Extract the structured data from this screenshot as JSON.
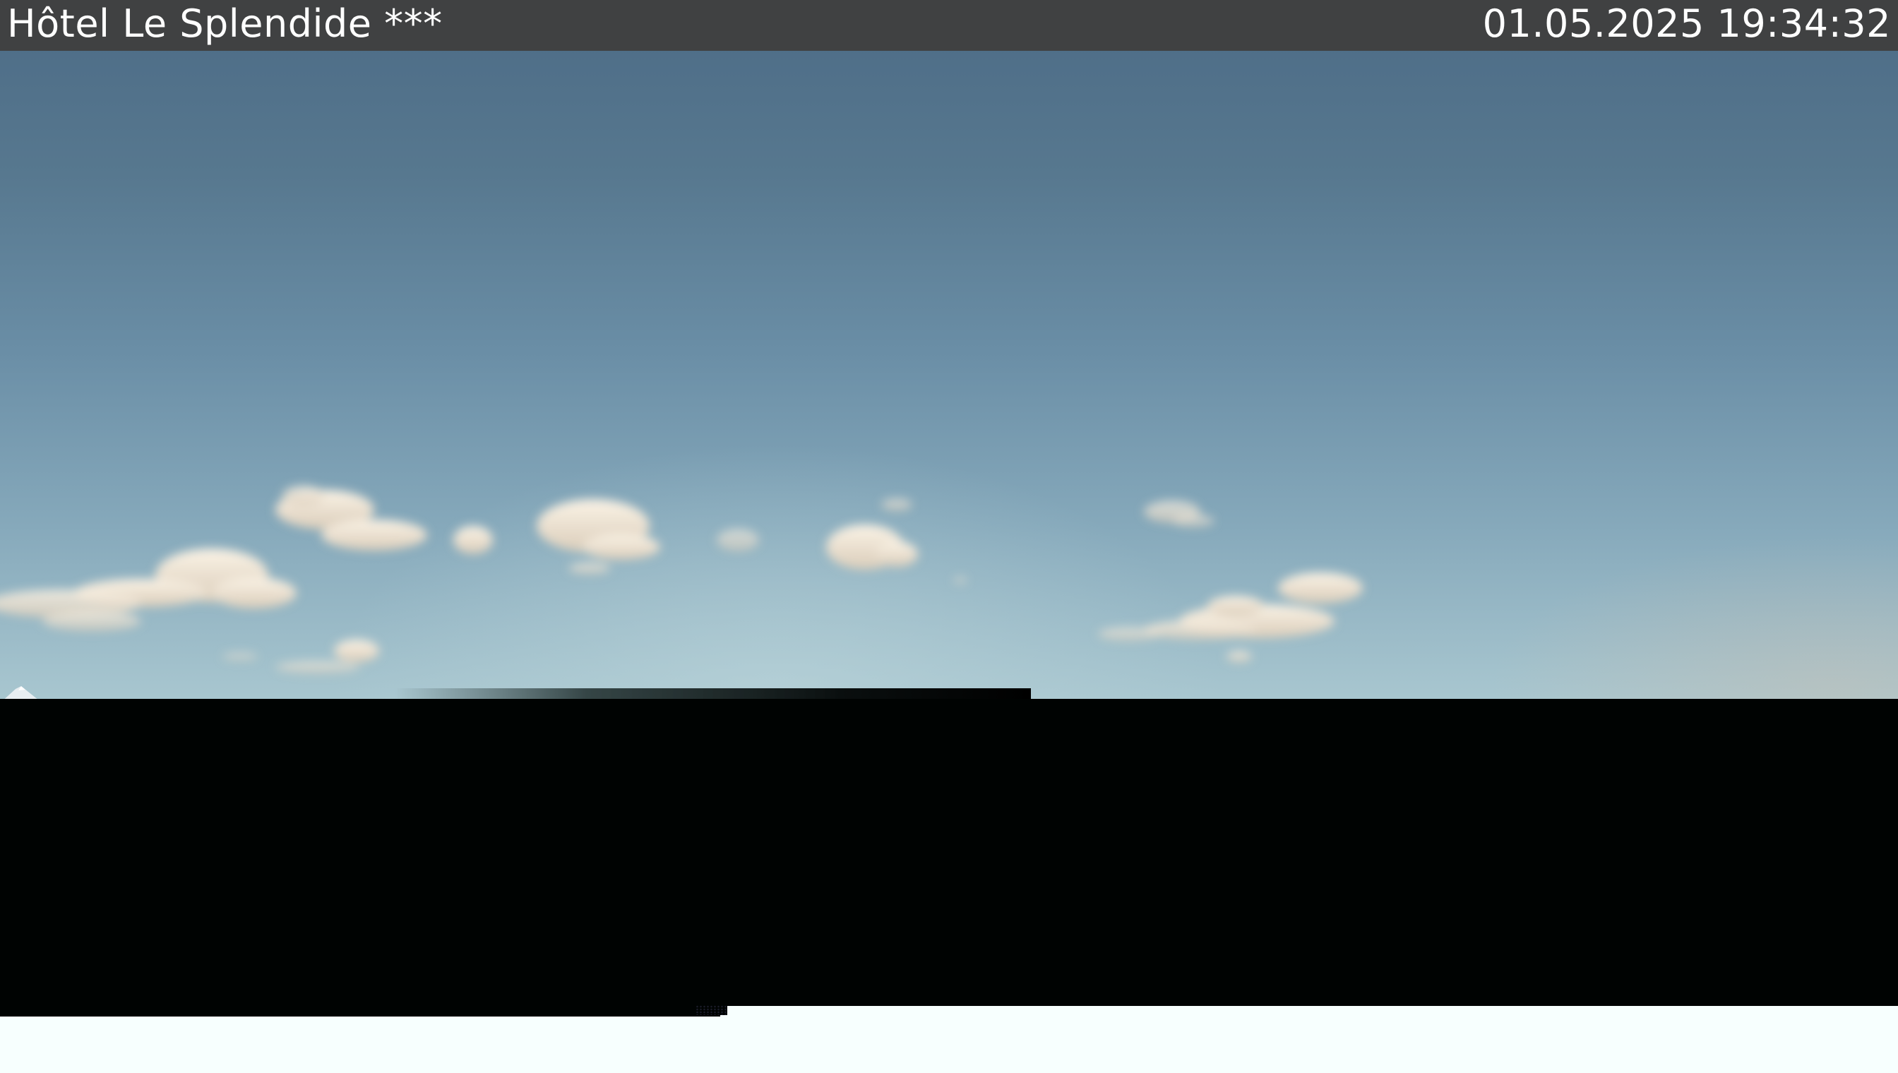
{
  "overlay": {
    "title": "Hôtel Le Splendide ***",
    "timestamp": "01.05.2025 19:34:32"
  },
  "colors": {
    "overlay_bg": "#404040",
    "overlay_text": "#ffffff",
    "sky_top": "#4c6b86",
    "sky_horizon": "#a9c7d0",
    "cloud": "#f1e6d6",
    "foreground_dark": "#000302",
    "bottom_band": "#f7fffe"
  }
}
